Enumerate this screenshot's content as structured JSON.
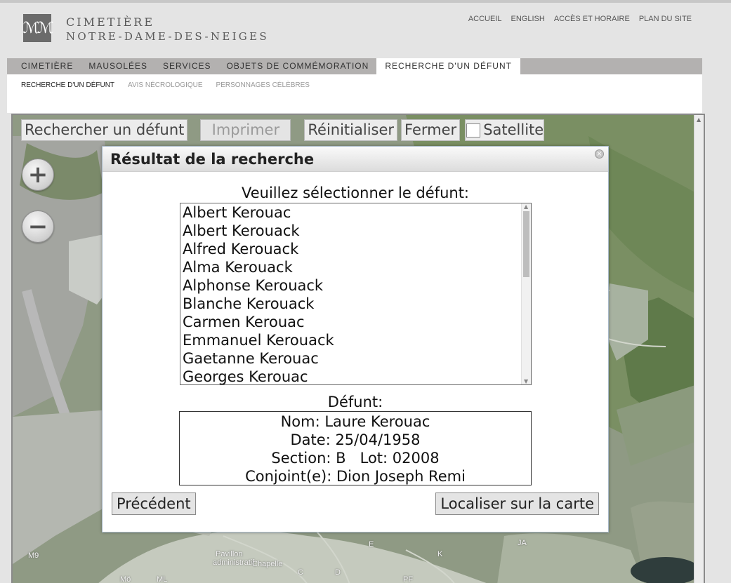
{
  "header": {
    "logo_icon": "monogram-logo-icon",
    "logo_glyph": "ℳℳ",
    "site_name_line1": "CIMETIÈRE",
    "site_name_line2": "NOTRE-DAME-DES-NEIGES",
    "util_links": [
      "ACCUEIL",
      "ENGLISH",
      "ACCÈS ET HORAIRE",
      "PLAN DU SITE"
    ]
  },
  "main_nav": {
    "tabs": [
      "CIMETIÈRE",
      "MAUSOLÉES",
      "SERVICES",
      "OBJETS DE COMMÉMORATION",
      "RECHERCHE D'UN DÉFUNT"
    ],
    "active": "RECHERCHE D'UN DÉFUNT"
  },
  "sub_nav": {
    "items": [
      "RECHERCHE D'UN DÉFUNT",
      "AVIS NÉCROLOGIQUE",
      "PERSONNAGES CÉLÈBRES"
    ],
    "active": "RECHERCHE D'UN DÉFUNT"
  },
  "map_toolbar": {
    "search_label": "Rechercher un défunt",
    "print_label": "Imprimer",
    "reset_label": "Réinitialiser",
    "close_label": "Fermer",
    "satellite_label": "Satellite",
    "satellite_checked": false
  },
  "map": {
    "zoom_in": "+",
    "zoom_out": "−",
    "labels": [
      "Pavillon",
      "administratif",
      "Chapelle",
      "M9",
      "Mö",
      "ML",
      "C",
      "D",
      "E",
      "K",
      "JA",
      "PF"
    ]
  },
  "dialog": {
    "title": "Résultat de la recherche",
    "close_icon": "close-icon",
    "prompt": "Veuillez sélectionner le défunt:",
    "results": [
      "Albert Kerouac",
      "Albert Kerouack",
      "Alfred Kerouack",
      "Alma Kerouack",
      "Alphonse Kerouack",
      "Blanche Kerouack",
      "Carmen Kerouac",
      "Emmanuel Kerouack",
      "Gaetanne Kerouac",
      "Georges Kerouac"
    ],
    "defunt_label": "Défunt:",
    "defunt": {
      "nom": "Nom: Laure Kerouac",
      "date": "Date: 25/04/1958",
      "section_lot": "Section: B   Lot: 02008",
      "conjoint": "Conjoint(e): Dion Joseph Remi"
    },
    "prev_label": "Précédent",
    "locate_label": "Localiser sur la carte"
  },
  "colors": {
    "nav_bg": "#b3b1b0",
    "page_bg": "#e4e4e4",
    "logo_bg": "#6b6b6b",
    "dialog_border": "#a7b8c8"
  }
}
